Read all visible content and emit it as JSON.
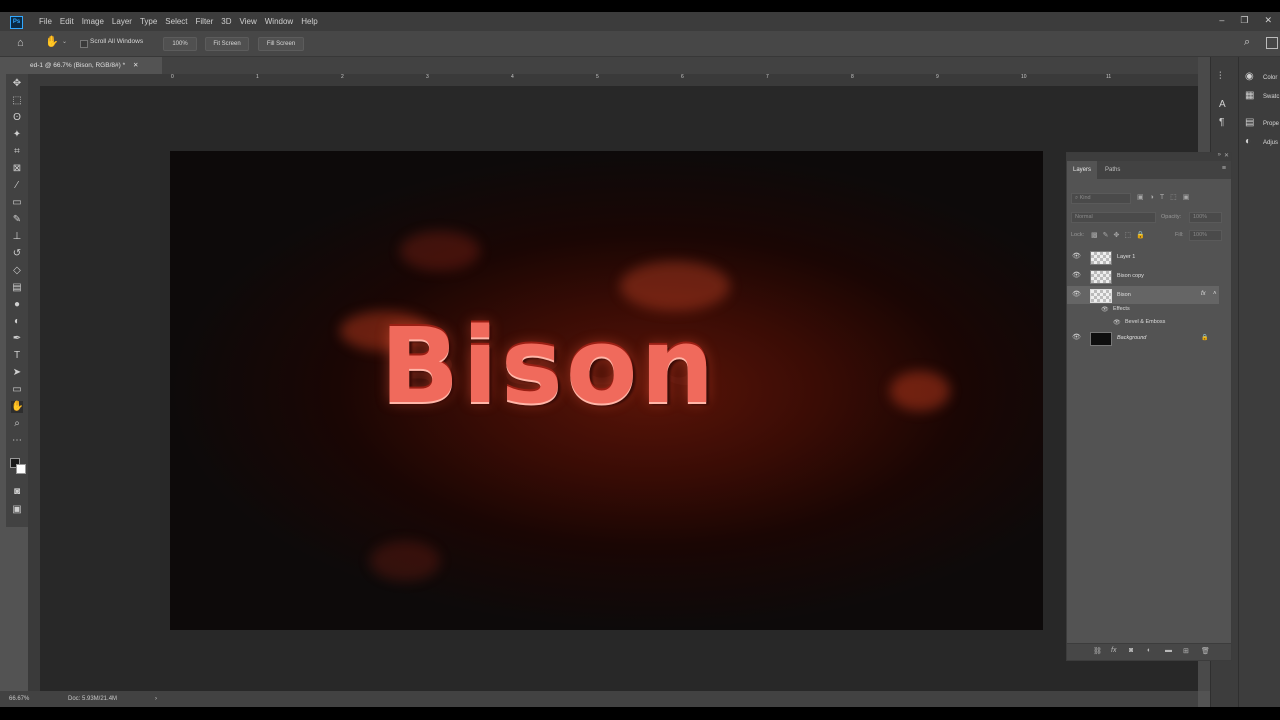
{
  "app": {
    "logo": "Ps"
  },
  "menu": [
    "File",
    "Edit",
    "Image",
    "Layer",
    "Type",
    "Select",
    "Filter",
    "3D",
    "View",
    "Window",
    "Help"
  ],
  "window_controls": {
    "minimize": "–",
    "restore": "❐",
    "close": "✕"
  },
  "options_bar": {
    "scroll_all_windows": "Scroll All Windows",
    "zoom_btn": "100%",
    "fit_screen": "Fit Screen",
    "fill_screen": "Fill Screen"
  },
  "document": {
    "tab_title": "ed-1 @ 66.7% (Bison, RGB/8#) *",
    "tab_close": "✕"
  },
  "ruler_marks": [
    "0",
    "1",
    "2",
    "3",
    "4",
    "5",
    "6",
    "7",
    "8",
    "9",
    "10",
    "11"
  ],
  "canvas": {
    "text": "Bison"
  },
  "status": {
    "zoom": "66.67%",
    "doc": "Doc: 5.93M/21.4M"
  },
  "dock": {
    "color": "Color",
    "swatches": "Swatc",
    "properties": "Prope",
    "adjustments": "Adjus"
  },
  "layers_panel": {
    "tabs": [
      "Layers",
      "Paths"
    ],
    "kind_placeholder": "Kind",
    "blend_mode": "Normal",
    "opacity_label": "Opacity:",
    "opacity_value": "100%",
    "lock_label": "Lock:",
    "fill_label": "Fill:",
    "fill_value": "100%",
    "layers": [
      {
        "name": "Layer 1"
      },
      {
        "name": "Bison copy"
      },
      {
        "name": "Bison",
        "fx": "fx"
      },
      {
        "name": "Background"
      }
    ],
    "effects_label": "Effects",
    "bevel_label": "Bevel & Emboss"
  }
}
